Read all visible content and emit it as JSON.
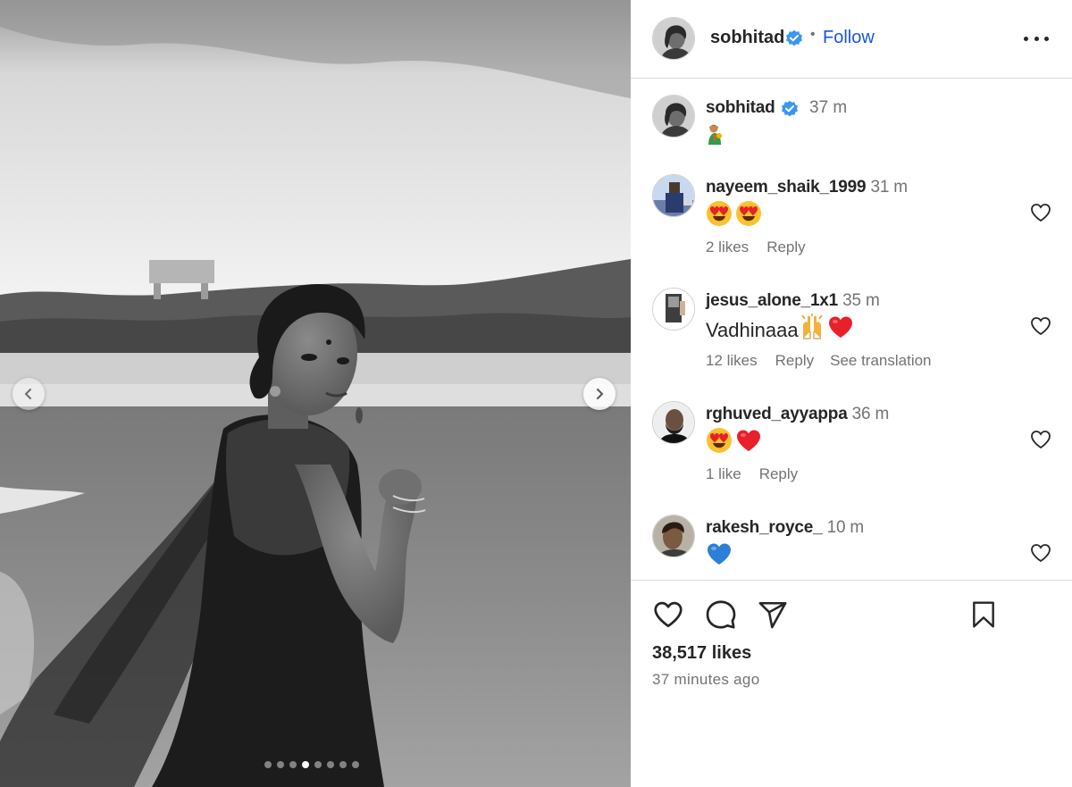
{
  "post": {
    "author": "sobhitad",
    "follow_label": "Follow",
    "separator": "•",
    "slide_count": 8,
    "active_slide": 3
  },
  "caption": {
    "username": "sobhitad",
    "time": "37 m",
    "text_emoji": "woman-with-flower-emoji"
  },
  "comments": [
    {
      "username": "nayeem_shaik_1999",
      "time": "31 m",
      "text": "",
      "emojis": [
        "heart-eyes",
        "heart-eyes"
      ],
      "likes": "2 likes",
      "reply": "Reply",
      "translate": ""
    },
    {
      "username": "jesus_alone_1x1",
      "time": "35 m",
      "text": "Vadhinaaa",
      "emojis": [
        "raising-hands",
        "red-heart"
      ],
      "likes": "12 likes",
      "reply": "Reply",
      "translate": "See translation"
    },
    {
      "username": "rghuved_ayyappa",
      "time": "36 m",
      "text": "",
      "emojis": [
        "heart-eyes",
        "red-heart"
      ],
      "likes": "1 like",
      "reply": "Reply",
      "translate": ""
    },
    {
      "username": "rakesh_royce_",
      "time": "10 m",
      "text": "",
      "emojis": [
        "blue-heart"
      ],
      "likes": "",
      "reply": "",
      "translate": ""
    }
  ],
  "footer": {
    "likes": "38,517 likes",
    "posted": "37 minutes ago"
  },
  "icons": [
    "heart-icon",
    "comment-icon",
    "share-icon",
    "bookmark-icon",
    "more-icon",
    "verified-icon",
    "chevron-left-icon",
    "chevron-right-icon"
  ],
  "colors": {
    "verified": "#3897f0",
    "follow": "#1a55d8",
    "red_heart": "#e8202a",
    "blue_heart": "#2c7fd6"
  }
}
